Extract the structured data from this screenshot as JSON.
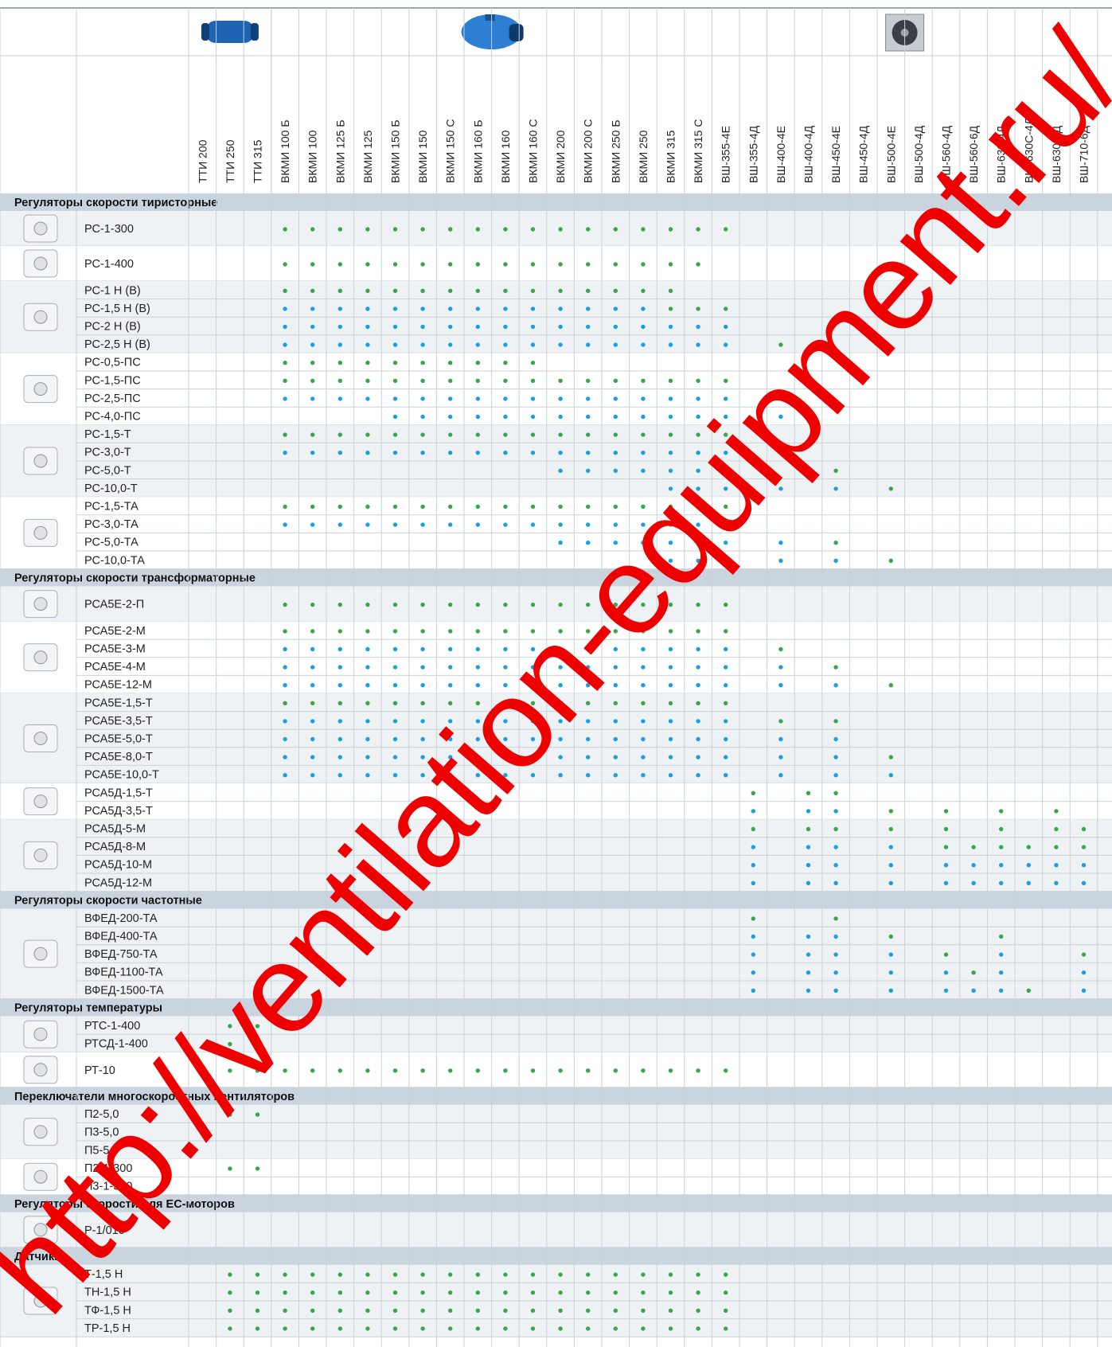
{
  "header": {
    "product_groups": [
      {
        "name": "TTI",
        "color": "#1f63b3"
      },
      {
        "name": "VKMI",
        "color": "#2d7fd4"
      },
      {
        "name": "VSh",
        "color": "#8d9399"
      }
    ]
  },
  "columns": [
    "ТТИ 200",
    "ТТИ 250",
    "ТТИ 315",
    "ВКМИ 100 Б",
    "ВКМИ 100",
    "ВКМИ 125 Б",
    "ВКМИ 125",
    "ВКМИ 150 Б",
    "ВКМИ 150",
    "ВКМИ 150 С",
    "ВКМИ 160 Б",
    "ВКМИ 160",
    "ВКМИ 160 С",
    "ВКМИ 200",
    "ВКМИ 200 С",
    "ВКМИ 250 Б",
    "ВКМИ 250",
    "ВКМИ 315",
    "ВКМИ 315 С",
    "ВШ-355-4Е",
    "ВШ-355-4Д",
    "ВШ-400-4Е",
    "ВШ-400-4Д",
    "ВШ-450-4Е",
    "ВШ-450-4Д",
    "ВШ-500-4Е",
    "ВШ-500-4Д",
    "ВШ-560-4Д",
    "ВШ-560-6Д",
    "ВШ-630-4Д",
    "ВШ-630С-4Д",
    "ВШ-630-6Д",
    "ВШ-710-6Д"
  ],
  "legend_colors": {
    "g": "#3aa64a",
    "b": "#1aa0e0"
  },
  "sections": [
    {
      "title": "Регуляторы скорости тиристорные",
      "groups": [
        {
          "icon": "rotary-controller-icon",
          "rows": [
            {
              "model": "РС-1-300",
              "marks": "...GGGGGGGGGGGGGGGGG............."
            }
          ]
        },
        {
          "icon": "round-knob-controller-icon",
          "rows": [
            {
              "model": "РС-1-400",
              "marks": "...GGGGGGGGGGGGGGGG.............."
            }
          ]
        },
        {
          "icon": "wall-controller-icon",
          "rows": [
            {
              "model": "РС-1 Н (В)",
              "marks": "...GGGGGGGGGGGGGGG..............."
            },
            {
              "model": "РС-1,5 Н (В)",
              "marks": "...BBBBBBBBBBBBBBGGG............."
            },
            {
              "model": "РС-2 Н (В)",
              "marks": "...BBBBBBBBBBBBBBBBB............."
            },
            {
              "model": "РС-2,5 Н (В)",
              "marks": "...BBBBBBBBBBBBBBBBB.G..........."
            }
          ]
        },
        {
          "icon": "square-knob-controller-icon",
          "rows": [
            {
              "model": "РС-0,5-ПС",
              "marks": "...GGGGGGGGGG..................."
            },
            {
              "model": "РС-1,5-ПС",
              "marks": "...GGGGGGGGGGGGGGGGG............."
            },
            {
              "model": "РС-2,5-ПС",
              "marks": "...BBBBBBBBBBBBBBBBB.G..........."
            },
            {
              "model": "РС-4,0-ПС",
              "marks": ".......BBBBBBBBBBBBB.B..........."
            }
          ]
        },
        {
          "icon": "box-controller-icon",
          "rows": [
            {
              "model": "РС-1,5-Т",
              "marks": "...GGGGGGGGGGGGGGGGG............."
            },
            {
              "model": "РС-3,0-Т",
              "marks": "...BBBBBBBBBBBBBBBBB............."
            },
            {
              "model": "РС-5,0-Т",
              "marks": ".............BBBBBBB...G........."
            },
            {
              "model": "РС-10,0-Т",
              "marks": ".................BBB.B.B.G......."
            }
          ]
        },
        {
          "icon": "box-controller-icon",
          "rows": [
            {
              "model": "РС-1,5-ТА",
              "marks": "...GGGGGGGGGGGGGGGGG............."
            },
            {
              "model": "РС-3,0-ТА",
              "marks": "...BBBBBBBBBBBBBBBBB............."
            },
            {
              "model": "РС-5,0-ТА",
              "marks": ".............BBBBBBB.B.G........."
            },
            {
              "model": "РС-10,0-ТА",
              "marks": ".................BBB.B.B.G......."
            }
          ]
        }
      ]
    },
    {
      "title": "Регуляторы скорости трансформаторные",
      "groups": [
        {
          "icon": "small-box-controller-icon",
          "rows": [
            {
              "model": "РСА5Е-2-П",
              "marks": "...GGGGGGGGGGGGGGGGG............."
            }
          ]
        },
        {
          "icon": "blue-box-controller-icon",
          "rows": [
            {
              "model": "РСА5Е-2-М",
              "marks": "...GGGGGGGGGGGGGGGGG............."
            },
            {
              "model": "РСА5Е-3-М",
              "marks": "...BBBBBBBBBBBBBBBBB.G..........."
            },
            {
              "model": "РСА5Е-4-М",
              "marks": "...BBBBBBBBBBBBBBBBB.B.G........."
            },
            {
              "model": "РСА5Е-12-М",
              "marks": "...BBBBBBBBBBBBBBBBB.B.B.G......."
            }
          ]
        },
        {
          "icon": "box-controller-icon",
          "rows": [
            {
              "model": "РСА5Е-1,5-Т",
              "marks": "...GGGGGGGGGGGGGGGGG............."
            },
            {
              "model": "РСА5Е-3,5-Т",
              "marks": "...BBBBBBBBBBBBBBBBB.G.G........."
            },
            {
              "model": "РСА5Е-5,0-Т",
              "marks": "...BBBBBBBBBBBBBBBBB.B.B........."
            },
            {
              "model": "РСА5Е-8,0-Т",
              "marks": "...BBBBBBBBBBBBBBBBB.B.B.G......."
            },
            {
              "model": "РСА5Е-10,0-Т",
              "marks": "...BBBBBBBBBBBBBBBBB.B.B.B......."
            }
          ]
        },
        {
          "icon": "box-controller-icon",
          "rows": [
            {
              "model": "РСА5Д-1,5-Т",
              "marks": "....................G.GG........."
            },
            {
              "model": "РСА5Д-3,5-Т",
              "marks": "....................B.BB.G.G.G.G."
            }
          ]
        },
        {
          "icon": "wall-panel-controller-icon",
          "rows": [
            {
              "model": "РСА5Д-5-М",
              "marks": "....................G.GG.G.G.G.GG"
            },
            {
              "model": "РСА5Д-8-М",
              "marks": "....................B.BB.B.GGGGGG"
            },
            {
              "model": "РСА5Д-10-М",
              "marks": "....................B.BB.B.BBBBBB"
            },
            {
              "model": "РСА5Д-12-М",
              "marks": "....................B.BB.B.BBBBBB"
            }
          ]
        }
      ]
    },
    {
      "title": "Регуляторы скорости частотные",
      "groups": [
        {
          "icon": "frequency-converter-icon",
          "rows": [
            {
              "model": "ВФЕД-200-ТА",
              "marks": "....................G..G........."
            },
            {
              "model": "ВФЕД-400-ТА",
              "marks": "....................B.BB.G...G...."
            },
            {
              "model": "ВФЕД-750-ТА",
              "marks": "....................B.BB.B.G.B..G."
            },
            {
              "model": "ВФЕД-1100-ТА",
              "marks": "....................B.BB.B.BGB..BG"
            },
            {
              "model": "ВФЕД-1500-ТА",
              "marks": "....................B.BB.B.BBBG.BB"
            }
          ]
        }
      ]
    },
    {
      "title": "Регуляторы температуры",
      "groups": [
        {
          "icon": "thermostat-remote-icon",
          "rows": [
            {
              "model": "РТС-1-400",
              "marks": ".GG.............................."
            },
            {
              "model": "РТСД-1-400",
              "marks": ".GG.............................."
            }
          ]
        },
        {
          "icon": "thermostat-knob-icon",
          "rows": [
            {
              "model": "РТ-10",
              "marks": ".GGGGGGGGGGGGGGGGGGG............."
            }
          ]
        }
      ]
    },
    {
      "title": "Переключатели многоскоростных вентиляторов",
      "groups": [
        {
          "icon": "switch-box-icon",
          "rows": [
            {
              "model": "П2-5,0",
              "marks": ".GG.............................."
            },
            {
              "model": "П3-5,0",
              "marks": "................................."
            },
            {
              "model": "П5-5,0",
              "marks": "................................."
            }
          ]
        },
        {
          "icon": "wall-switch-icon",
          "rows": [
            {
              "model": "П2-1-300",
              "marks": ".GG.............................."
            },
            {
              "model": "П3-1-300",
              "marks": "................................."
            }
          ]
        }
      ]
    },
    {
      "title": "Регуляторы скорости для ЕС-моторов",
      "groups": [
        {
          "icon": "ec-controller-icon",
          "rows": [
            {
              "model": "Р-1/010",
              "marks": "................................."
            }
          ]
        }
      ]
    },
    {
      "title": "Датчики",
      "groups": [
        {
          "icon": "sensor-box-icon",
          "rows": [
            {
              "model": "Т-1,5 Н",
              "marks": ".GGGGGGGGGGGGGGGGGGG............."
            },
            {
              "model": "ТН-1,5 Н",
              "marks": ".GGGGGGGGGGGGGGGGGGG............."
            },
            {
              "model": "ТФ-1,5 Н",
              "marks": ".GGGGGGGGGGGGGGGGGGG............."
            },
            {
              "model": "ТР-1,5 Н",
              "marks": ".GGGGGGGGGGGGGGGGGGG............."
            }
          ]
        }
      ]
    }
  ],
  "watermark": "http://ventilation-equipment.ru/"
}
